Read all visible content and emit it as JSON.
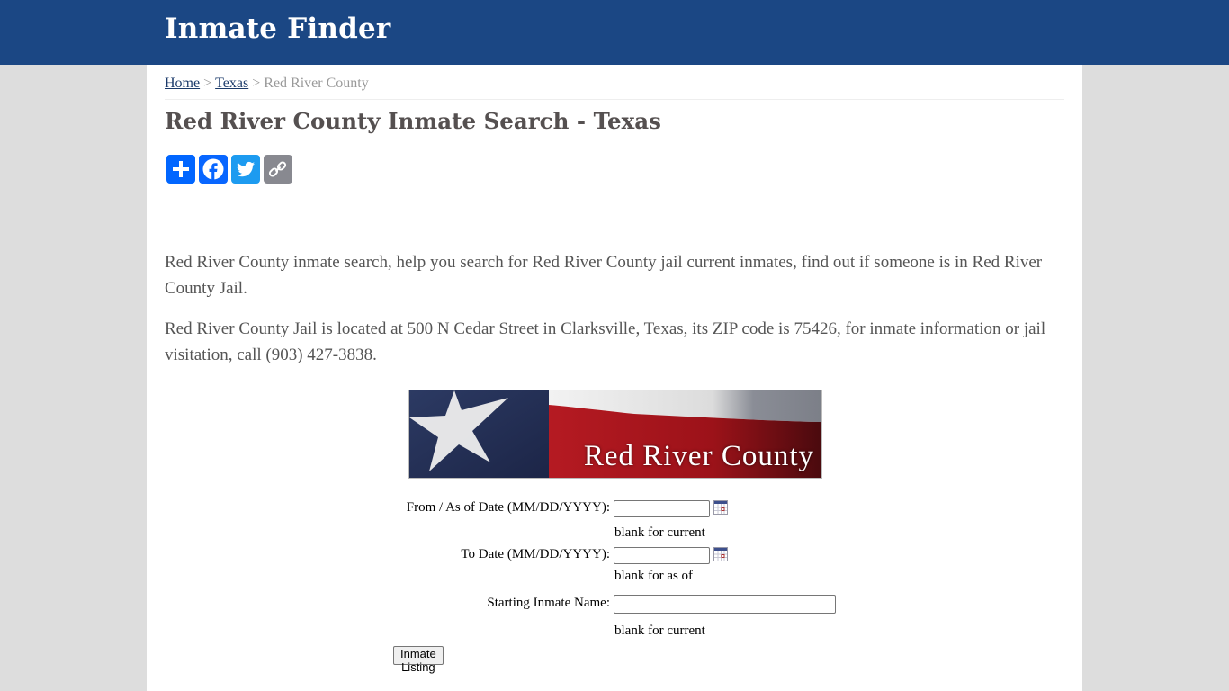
{
  "header": {
    "brand": "Inmate Finder",
    "brand_color": "#1b4784"
  },
  "breadcrumb": {
    "items": [
      {
        "label": "Home",
        "link": true
      },
      {
        "label": "Texas",
        "link": true
      },
      {
        "label": "Red River County",
        "link": false
      }
    ],
    "separator": ">"
  },
  "page": {
    "title": "Red River County Inmate Search - Texas",
    "share_buttons": [
      {
        "name": "share",
        "icon": "plus-icon",
        "color": "#0166ff"
      },
      {
        "name": "facebook",
        "icon": "facebook-icon",
        "color": "#0866ff"
      },
      {
        "name": "twitter",
        "icon": "twitter-icon",
        "color": "#1d9bf0"
      },
      {
        "name": "copy-link",
        "icon": "link-icon",
        "color": "#888990"
      }
    ],
    "paragraphs": [
      "Red River County inmate search, help you search for Red River County jail current inmates, find out if someone is in Red River County Jail.",
      "Red River County Jail is located at 500 N Cedar Street in Clarksville, Texas, its ZIP code is 75426, for inmate information or jail visitation, call (903) 427-3838."
    ],
    "banner_text": "Red River County"
  },
  "form": {
    "from_date": {
      "label": "From / As of Date (MM/DD/YYYY):",
      "value": "",
      "hint": "blank for current"
    },
    "to_date": {
      "label": "To Date (MM/DD/YYYY):",
      "value": "",
      "hint": "blank for as of"
    },
    "inmate_name": {
      "label": "Starting Inmate Name:",
      "value": "",
      "hint": "blank for current"
    },
    "submit_label": "Inmate Listing"
  }
}
